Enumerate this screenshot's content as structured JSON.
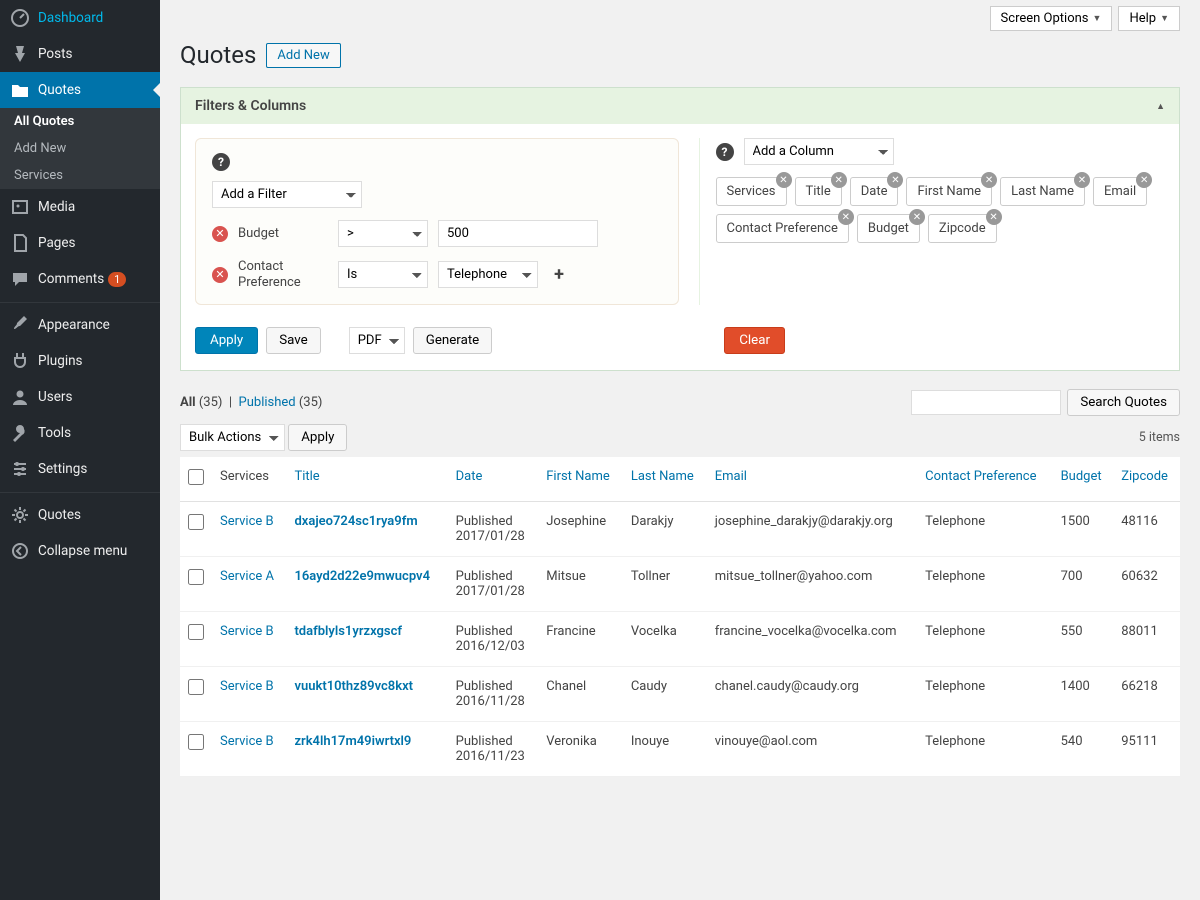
{
  "sidebar": {
    "items": [
      {
        "label": "Dashboard",
        "icon": "gauge"
      },
      {
        "label": "Posts",
        "icon": "pin"
      },
      {
        "label": "Quotes",
        "icon": "folder",
        "active": true,
        "sub": [
          {
            "label": "All Quotes",
            "sel": true
          },
          {
            "label": "Add New"
          },
          {
            "label": "Services"
          }
        ]
      },
      {
        "label": "Media",
        "icon": "media"
      },
      {
        "label": "Pages",
        "icon": "page"
      },
      {
        "label": "Comments",
        "icon": "comment",
        "badge": "1"
      },
      {
        "label": "Appearance",
        "icon": "brush"
      },
      {
        "label": "Plugins",
        "icon": "plug"
      },
      {
        "label": "Users",
        "icon": "user"
      },
      {
        "label": "Tools",
        "icon": "wrench"
      },
      {
        "label": "Settings",
        "icon": "sliders"
      },
      {
        "label": "Quotes",
        "icon": "gear"
      },
      {
        "label": "Collapse menu",
        "icon": "collapse"
      }
    ]
  },
  "topbar": {
    "screen_options": "Screen Options",
    "help": "Help"
  },
  "page": {
    "title": "Quotes",
    "add_new": "Add New"
  },
  "panel": {
    "title": "Filters & Columns",
    "add_filter": "Add a Filter",
    "add_column": "Add a Column"
  },
  "filters": [
    {
      "label": "Budget",
      "op": ">",
      "val": "500"
    },
    {
      "label": "Contact Preference",
      "op": "Is",
      "val": "Telephone"
    }
  ],
  "column_chips": [
    "Services",
    "Title",
    "Date",
    "First Name",
    "Last Name",
    "Email",
    "Contact Preference",
    "Budget",
    "Zipcode"
  ],
  "actions": {
    "apply": "Apply",
    "save": "Save",
    "format": "PDF",
    "generate": "Generate",
    "clear": "Clear"
  },
  "views": {
    "all": "All",
    "all_count": "(35)",
    "published": "Published",
    "published_count": "(35)"
  },
  "search": {
    "button": "Search Quotes"
  },
  "bulk": {
    "select": "Bulk Actions",
    "apply": "Apply"
  },
  "items_count": "5 items",
  "columns": [
    "Services",
    "Title",
    "Date",
    "First Name",
    "Last Name",
    "Email",
    "Contact Preference",
    "Budget",
    "Zipcode"
  ],
  "rows": [
    {
      "service": "Service B",
      "title": "dxajeo724sc1rya9fm",
      "date_status": "Published",
      "date": "2017/01/28",
      "first": "Josephine",
      "last": "Darakjy",
      "email": "josephine_darakjy@darakjy.org",
      "pref": "Telephone",
      "budget": "1500",
      "zip": "48116"
    },
    {
      "service": "Service A",
      "title": "16ayd2d22e9mwucpv4",
      "date_status": "Published",
      "date": "2017/01/28",
      "first": "Mitsue",
      "last": "Tollner",
      "email": "mitsue_tollner@yahoo.com",
      "pref": "Telephone",
      "budget": "700",
      "zip": "60632"
    },
    {
      "service": "Service B",
      "title": "tdafblyls1yrzxgscf",
      "date_status": "Published",
      "date": "2016/12/03",
      "first": "Francine",
      "last": "Vocelka",
      "email": "francine_vocelka@vocelka.com",
      "pref": "Telephone",
      "budget": "550",
      "zip": "88011"
    },
    {
      "service": "Service B",
      "title": "vuukt10thz89vc8kxt",
      "date_status": "Published",
      "date": "2016/11/28",
      "first": "Chanel",
      "last": "Caudy",
      "email": "chanel.caudy@caudy.org",
      "pref": "Telephone",
      "budget": "1400",
      "zip": "66218"
    },
    {
      "service": "Service B",
      "title": "zrk4lh17m49iwrtxl9",
      "date_status": "Published",
      "date": "2016/11/23",
      "first": "Veronika",
      "last": "Inouye",
      "email": "vinouye@aol.com",
      "pref": "Telephone",
      "budget": "540",
      "zip": "95111"
    }
  ]
}
